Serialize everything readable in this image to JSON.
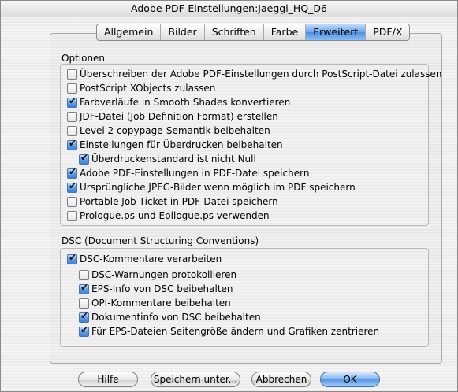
{
  "window": {
    "title": "Adobe PDF-Einstellungen:Jaeggi_HQ_D6"
  },
  "tabs": [
    {
      "label": "Allgemein",
      "active": false
    },
    {
      "label": "Bilder",
      "active": false
    },
    {
      "label": "Schriften",
      "active": false
    },
    {
      "label": "Farbe",
      "active": false
    },
    {
      "label": "Erweitert",
      "active": true
    },
    {
      "label": "PDF/X",
      "active": false
    }
  ],
  "options": {
    "label": "Optionen",
    "items": [
      {
        "label": "Überschreiben der Adobe PDF-Einstellungen durch PostScript-Datei zulassen",
        "checked": false
      },
      {
        "label": "PostScript XObjects zulassen",
        "checked": false
      },
      {
        "label": "Farbverläufe in Smooth Shades konvertieren",
        "checked": true
      },
      {
        "label": "JDF-Datei (Job Definition Format) erstellen",
        "checked": false
      },
      {
        "label": "Level 2 copypage-Semantik beibehalten",
        "checked": false
      },
      {
        "label": "Einstellungen für Überdrucken beibehalten",
        "checked": true
      },
      {
        "label": "Überdruckenstandard ist nicht Null",
        "checked": true
      },
      {
        "label": "Adobe PDF-Einstellungen in PDF-Datei speichern",
        "checked": true
      },
      {
        "label": "Ursprüngliche JPEG-Bilder wenn möglich im PDF speichern",
        "checked": true
      },
      {
        "label": "Portable Job Ticket in PDF-Datei speichern",
        "checked": false
      },
      {
        "label": "Prologue.ps und Epilogue.ps verwenden",
        "checked": false
      }
    ]
  },
  "dsc": {
    "label": "DSC (Document Structuring Conventions)",
    "items": [
      {
        "label": "DSC-Kommentare verarbeiten",
        "checked": true
      },
      {
        "label": "DSC-Warnungen protokollieren",
        "checked": false
      },
      {
        "label": "EPS-Info von DSC beibehalten",
        "checked": true
      },
      {
        "label": "OPI-Kommentare beibehalten",
        "checked": false
      },
      {
        "label": "Dokumentinfo von DSC beibehalten",
        "checked": true
      },
      {
        "label": "Für EPS-Dateien Seitengröße ändern und Grafiken zentrieren",
        "checked": true
      }
    ]
  },
  "buttons": {
    "help": "Hilfe",
    "save_as": "Speichern unter...",
    "cancel": "Abbrechen",
    "ok": "OK"
  }
}
